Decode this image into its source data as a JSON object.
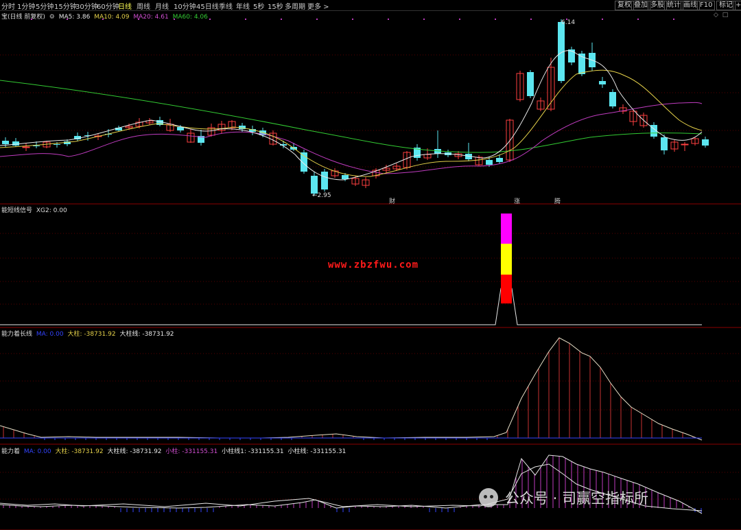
{
  "toolbar": {
    "periods": [
      "分时",
      "1分钟",
      "5分钟",
      "15分钟",
      "30分钟",
      "60分钟",
      "日线",
      "周线",
      "月线",
      "10分钟",
      "45日线",
      "季线",
      "年线",
      "5秒",
      "15秒",
      "多周期",
      "更多"
    ],
    "active_period": "日线",
    "right_buttons": [
      "复权",
      "叠加",
      "多股",
      "统计",
      "画线",
      "F10",
      "标记",
      "+自"
    ]
  },
  "main_panel": {
    "title": "宝(日线 前复权)",
    "ma": [
      {
        "label": "MA5: 3.86",
        "color": "#e8e8e8"
      },
      {
        "label": "MA10: 4.09",
        "color": "#e6d24a"
      },
      {
        "label": "MA20: 4.61",
        "color": "#d24fd2"
      },
      {
        "label": "MA60: 4.06",
        "color": "#33cc33"
      }
    ],
    "high_label": "6.14",
    "low_label": "2.95",
    "markers": [
      {
        "text": "财",
        "color": "#5b9bff"
      },
      {
        "text": "涨",
        "color": "#ff4040"
      },
      {
        "text": "腾",
        "color": "#ffae3c"
      }
    ]
  },
  "panel2": {
    "title": "能短线信号",
    "value": "XG2: 0.00"
  },
  "panel3": {
    "title": "能力着长线",
    "items": [
      {
        "text": "MA: 0.00",
        "color": "#3344ff"
      },
      {
        "text": "大柱: -38731.92",
        "color": "#e6d24a"
      },
      {
        "text": "大柱线: -38731.92",
        "color": "#e8e8e8"
      }
    ]
  },
  "panel4": {
    "title": "能力着",
    "items": [
      {
        "text": "MA: 0.00",
        "color": "#3344ff"
      },
      {
        "text": "大柱: -38731.92",
        "color": "#e6d24a"
      },
      {
        "text": "大柱线: -38731.92",
        "color": "#e8e8e8"
      },
      {
        "text": "小柱: -331155.31",
        "color": "#d24fd2"
      },
      {
        "text": "小柱线1: -331155.31",
        "color": "#e8e8e8"
      },
      {
        "text": "小柱线: -331155.31",
        "color": "#e8e8e8"
      }
    ]
  },
  "watermark": {
    "url": "www.zbzfwu.com",
    "wechat": "公众号 · 司赢空指标所"
  },
  "colors": {
    "up": "#ff4040",
    "down": "#5ce6f0",
    "grid": "#5a0000",
    "border": "#8b0000"
  }
}
